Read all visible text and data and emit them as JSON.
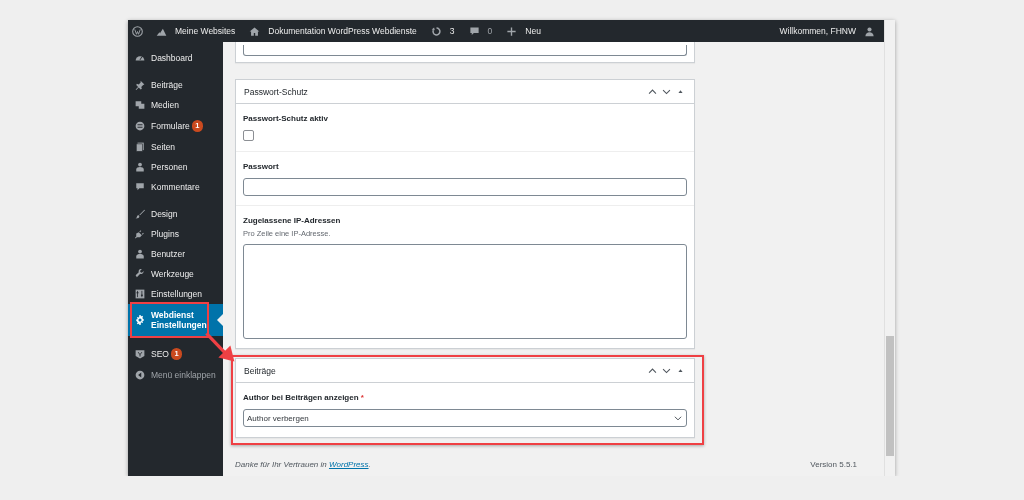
{
  "admin_bar": {
    "sites": "Meine Websites",
    "site": "Dokumentation WordPress Webdienste",
    "updates": "3",
    "comments": "0",
    "new": "Neu",
    "greeting": "Willkommen, FHNW"
  },
  "sidebar": {
    "items": [
      {
        "label": "Dashboard",
        "selected": false
      },
      {
        "label": "Beiträge",
        "selected": false
      },
      {
        "label": "Medien",
        "selected": false
      },
      {
        "label": "Formulare",
        "badge": "1",
        "selected": false
      },
      {
        "label": "Seiten",
        "selected": false
      },
      {
        "label": "Personen",
        "selected": false
      },
      {
        "label": "Kommentare",
        "selected": false
      },
      {
        "label": "Design",
        "selected": false
      },
      {
        "label": "Plugins",
        "selected": false
      },
      {
        "label": "Benutzer",
        "selected": false
      },
      {
        "label": "Werkzeuge",
        "selected": false
      },
      {
        "label": "Einstellungen",
        "selected": false
      },
      {
        "label": "Webdienst Einstellungen",
        "selected": true,
        "highlighted": true
      },
      {
        "label": "SEO",
        "badge": "1",
        "selected": false
      }
    ],
    "collapse": "Menü einklappen"
  },
  "boxes": [
    {
      "title": "Passwort-Schutz",
      "highlighted": false,
      "fields": [
        {
          "kind": "checkbox",
          "label": "Passwort-Schutz aktiv",
          "checked": false
        },
        {
          "kind": "text",
          "label": "Passwort"
        },
        {
          "kind": "textarea",
          "label": "Zugelassene IP-Adressen",
          "help": "Pro Zeile eine IP-Adresse."
        }
      ]
    },
    {
      "title": "Beiträge",
      "highlighted": true,
      "fields": [
        {
          "kind": "select",
          "label": "Author bei Beiträgen anzeigen",
          "required_mark": "*",
          "value": "Author verbergen"
        }
      ]
    }
  ],
  "footer": {
    "thanks_before": "Danke für Ihr Vertrauen in ",
    "thanks_link": "WordPress",
    "thanks_after": ".",
    "version": "Version 5.5.1"
  }
}
